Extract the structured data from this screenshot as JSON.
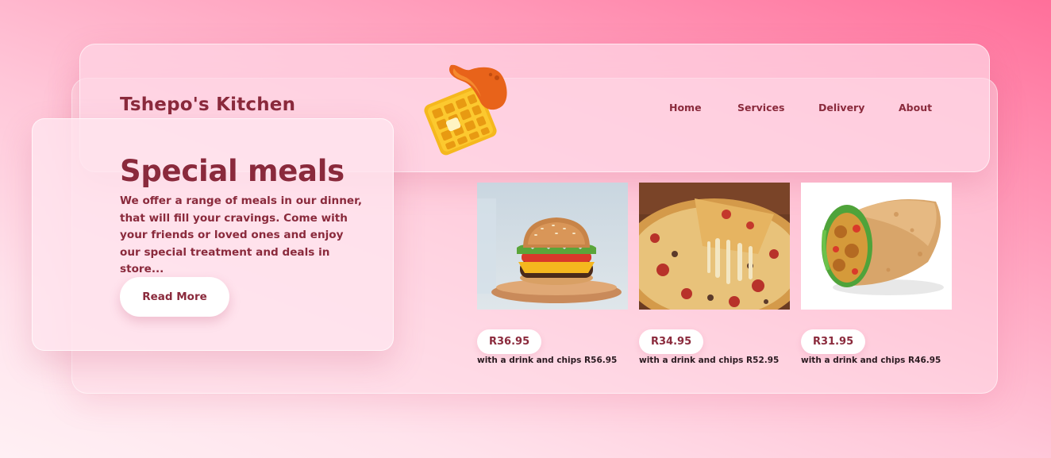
{
  "brand": {
    "name": "Tshepo's Kitchen",
    "logo_icon": "waffle-chicken-wing-icon"
  },
  "nav": {
    "items": [
      "Home",
      "Services",
      "Delivery",
      "About"
    ]
  },
  "hero": {
    "title": "Special meals",
    "description": "We offer a range of meals in our dinner, that will fill your cravings. Come with your friends or loved ones and enjoy our special treatment and deals in store...",
    "button_label": "Read More"
  },
  "menu": {
    "items": [
      {
        "image": "burger-image",
        "price": "R36.95",
        "combo": "with a drink and chips R56.95"
      },
      {
        "image": "pizza-image",
        "price": "R34.95",
        "combo": "with a drink and chips R52.95"
      },
      {
        "image": "wrap-image",
        "price": "R31.95",
        "combo": "with a drink and chips R46.95"
      }
    ]
  },
  "colors": {
    "accent": "#8a2a3c",
    "background_start": "#ff6f9a",
    "background_end": "#fff0f4"
  }
}
